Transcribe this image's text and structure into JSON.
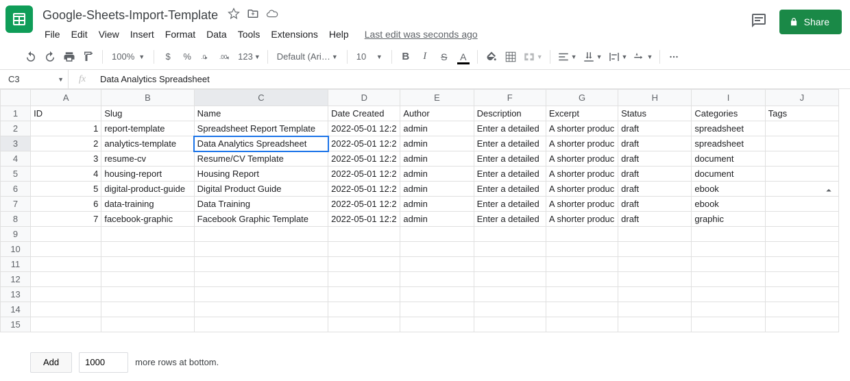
{
  "doc": {
    "title": "Google-Sheets-Import-Template",
    "last_edit": "Last edit was seconds ago"
  },
  "menu": {
    "file": "File",
    "edit": "Edit",
    "view": "View",
    "insert": "Insert",
    "format": "Format",
    "data": "Data",
    "tools": "Tools",
    "extensions": "Extensions",
    "help": "Help"
  },
  "share": {
    "label": "Share"
  },
  "toolbar": {
    "zoom": "100%",
    "currency": "$",
    "percent": "%",
    "num_fmt": "123",
    "font": "Default (Ari…",
    "size": "10"
  },
  "fx": {
    "cell_ref": "C3",
    "value": "Data Analytics Spreadsheet"
  },
  "columns": [
    "A",
    "B",
    "C",
    "D",
    "E",
    "F",
    "G",
    "H",
    "I",
    "J"
  ],
  "headers": {
    "A": "ID",
    "B": "Slug",
    "C": "Name",
    "D": "Date Created",
    "E": "Author",
    "F": "Description",
    "G": "Excerpt",
    "H": "Status",
    "I": "Categories",
    "J": "Tags"
  },
  "rows": [
    {
      "A": "1",
      "B": "report-template",
      "C": "Spreadsheet Report Template",
      "D": "2022-05-01 12:2",
      "E": "admin",
      "F": "Enter a detailed",
      "G": "A shorter produc",
      "H": "draft",
      "I": "spreadsheet",
      "J": ""
    },
    {
      "A": "2",
      "B": "analytics-template",
      "C": "Data Analytics Spreadsheet",
      "D": "2022-05-01 12:2",
      "E": "admin",
      "F": "Enter a detailed",
      "G": "A shorter produc",
      "H": "draft",
      "I": "spreadsheet",
      "J": ""
    },
    {
      "A": "3",
      "B": "resume-cv",
      "C": "Resume/CV Template",
      "D": "2022-05-01 12:2",
      "E": "admin",
      "F": "Enter a detailed",
      "G": "A shorter produc",
      "H": "draft",
      "I": "document",
      "J": ""
    },
    {
      "A": "4",
      "B": "housing-report",
      "C": "Housing Report",
      "D": "2022-05-01 12:2",
      "E": "admin",
      "F": "Enter a detailed",
      "G": "A shorter produc",
      "H": "draft",
      "I": "document",
      "J": ""
    },
    {
      "A": "5",
      "B": "digital-product-guide",
      "C": "Digital Product Guide",
      "D": "2022-05-01 12:2",
      "E": "admin",
      "F": "Enter a detailed",
      "G": "A shorter produc",
      "H": "draft",
      "I": "ebook",
      "J": ""
    },
    {
      "A": "6",
      "B": "data-training",
      "C": "Data Training",
      "D": "2022-05-01 12:2",
      "E": "admin",
      "F": "Enter a detailed",
      "G": "A shorter produc",
      "H": "draft",
      "I": "ebook",
      "J": ""
    },
    {
      "A": "7",
      "B": "facebook-graphic",
      "C": "Facebook Graphic Template",
      "D": "2022-05-01 12:2",
      "E": "admin",
      "F": "Enter a detailed",
      "G": "A shorter produc",
      "H": "draft",
      "I": "graphic",
      "J": ""
    }
  ],
  "total_rows": 15,
  "selected": {
    "row": 3,
    "col": "C"
  },
  "footer": {
    "add": "Add",
    "rows_value": "1000",
    "suffix": "more rows at bottom."
  }
}
